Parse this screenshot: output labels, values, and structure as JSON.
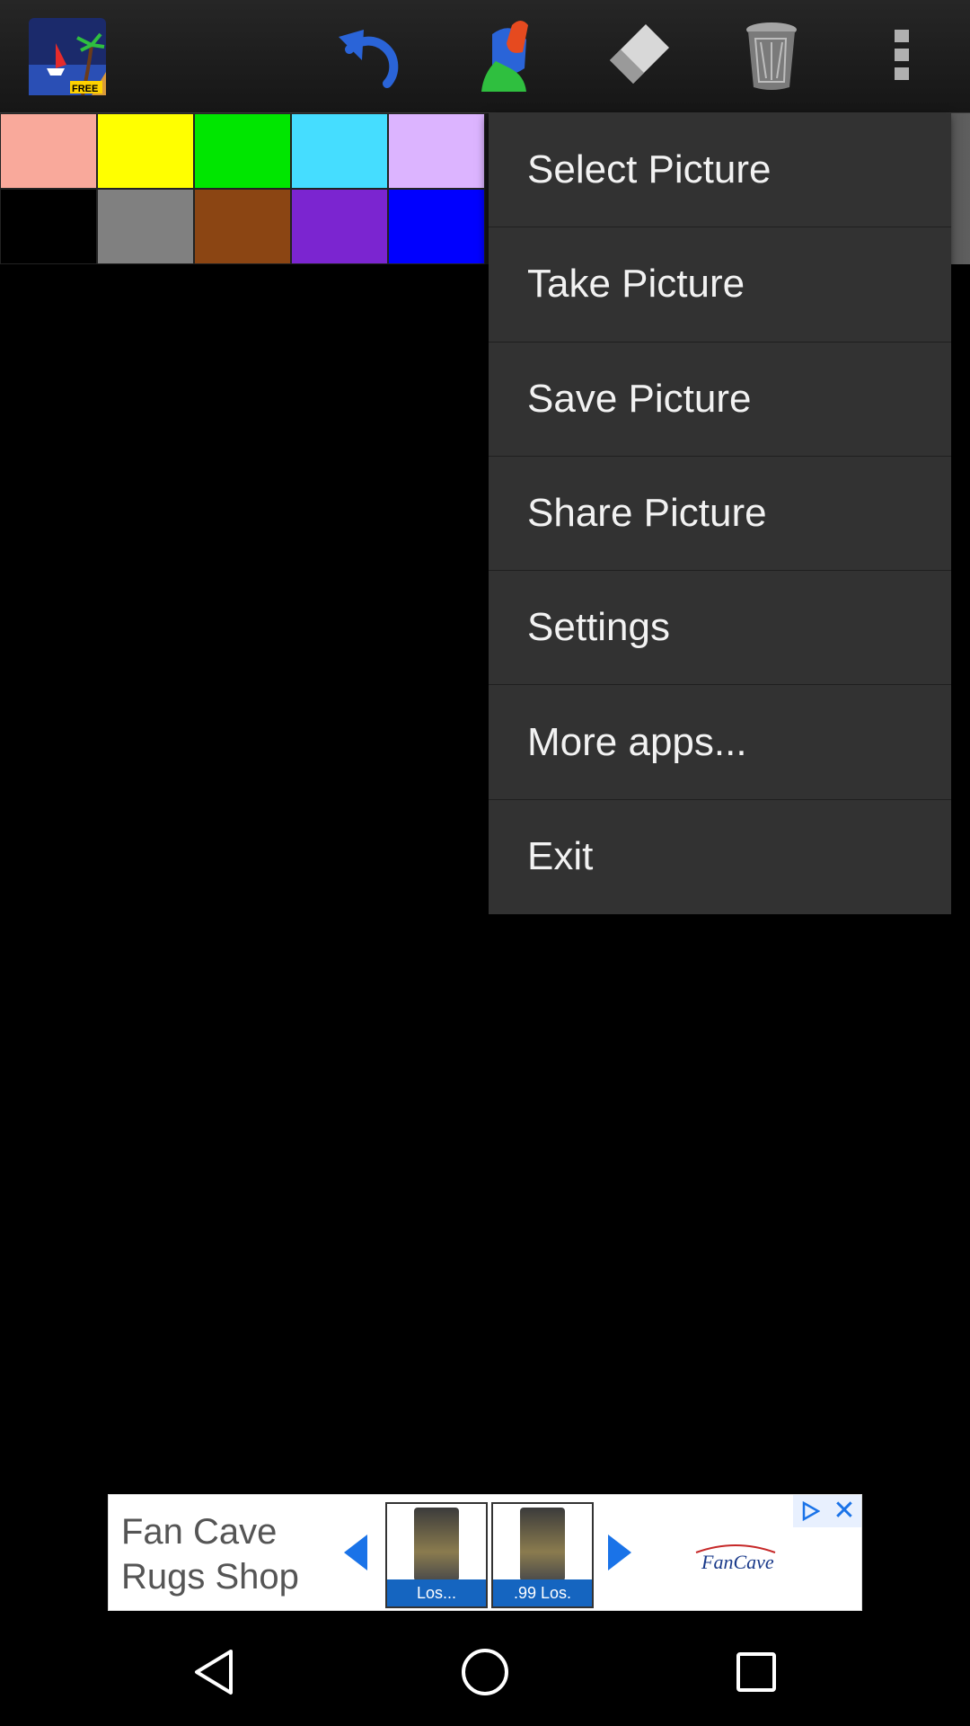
{
  "toolbar": {
    "app_icon": "app-logo-free-icon",
    "app_badge": "FREE",
    "buttons": [
      "undo-icon",
      "fill-bucket-icon",
      "eraser-icon",
      "trash-icon",
      "more-vertical-icon"
    ]
  },
  "palette": {
    "colors": [
      "#f9a99b",
      "#ffff00",
      "#00e600",
      "#45ddff",
      "#dcb4ff",
      "#000000",
      "#808080",
      "#8b4513",
      "#7b25d0",
      "#0000ff"
    ]
  },
  "menu": {
    "items": [
      {
        "label": "Select Picture"
      },
      {
        "label": "Take Picture"
      },
      {
        "label": "Save Picture"
      },
      {
        "label": "Share Picture"
      },
      {
        "label": "Settings"
      },
      {
        "label": "More apps..."
      },
      {
        "label": "Exit"
      }
    ]
  },
  "ad": {
    "title": "Fan Cave Rugs Shop",
    "thumb1_caption": "Los...",
    "thumb2_caption": ".99      Los.",
    "logo_text": "FanCave Rugs",
    "close_icon": "close-icon",
    "info_icon": "ad-choices-icon"
  },
  "navbar": {
    "buttons": [
      "back-icon",
      "home-icon",
      "recent-apps-icon"
    ]
  },
  "colors": {
    "menu_bg": "#323232",
    "accent_blue": "#1a73e8"
  }
}
